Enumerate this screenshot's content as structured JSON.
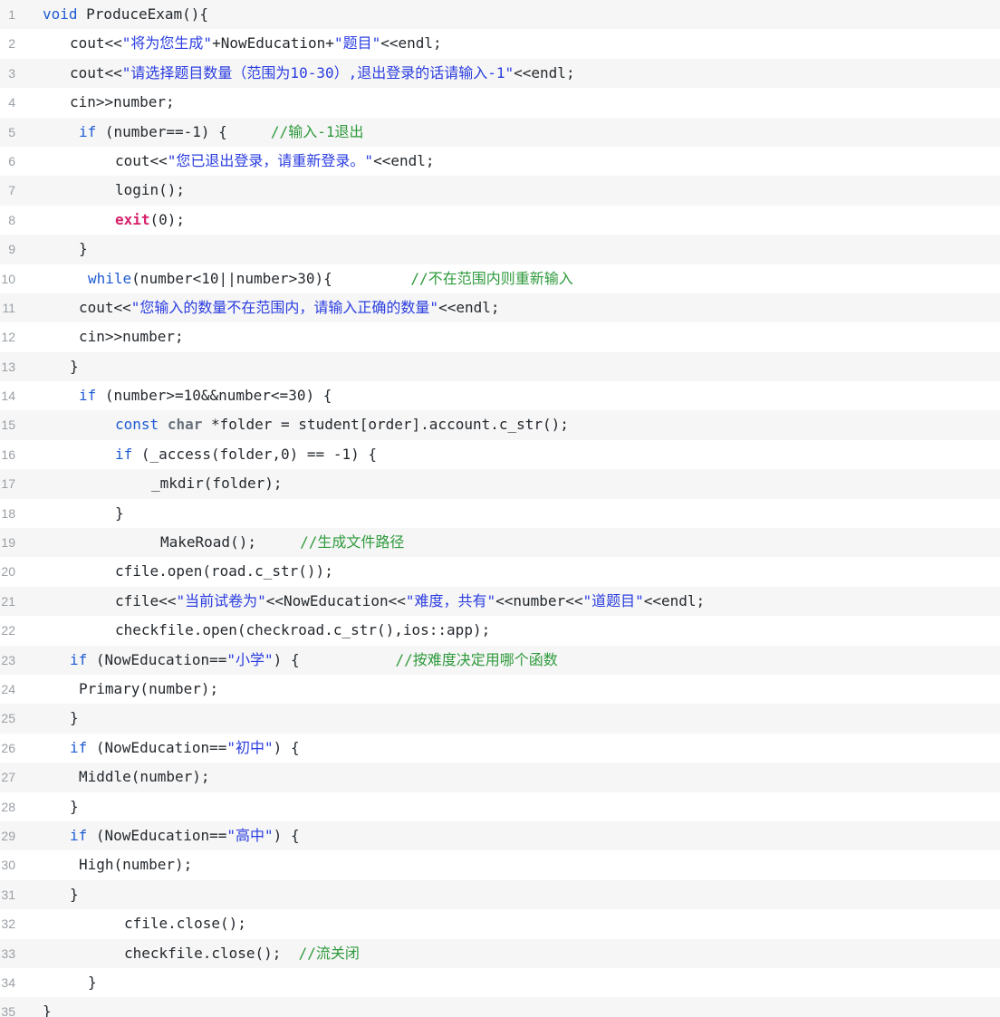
{
  "editor": {
    "lines": [
      {
        "num": "1",
        "indent": 0,
        "tokens": [
          {
            "t": "void",
            "c": "kw"
          },
          {
            "t": " ProduceExam(){",
            "c": ""
          }
        ]
      },
      {
        "num": "2",
        "indent": 3,
        "tokens": [
          {
            "t": "cout<<",
            "c": ""
          },
          {
            "t": "\"将为您生成\"",
            "c": "str"
          },
          {
            "t": "+NowEducation+",
            "c": ""
          },
          {
            "t": "\"题目\"",
            "c": "str"
          },
          {
            "t": "<<endl;",
            "c": ""
          }
        ]
      },
      {
        "num": "3",
        "indent": 3,
        "tokens": [
          {
            "t": "cout<<",
            "c": ""
          },
          {
            "t": "\"请选择题目数量（范围为10-30）,退出登录的话请输入-1\"",
            "c": "str"
          },
          {
            "t": "<<endl;",
            "c": ""
          }
        ]
      },
      {
        "num": "4",
        "indent": 3,
        "tokens": [
          {
            "t": "cin>>number;",
            "c": ""
          }
        ]
      },
      {
        "num": "5",
        "indent": 4,
        "tokens": [
          {
            "t": "if",
            "c": "kw"
          },
          {
            "t": " (number==-1) {     ",
            "c": ""
          },
          {
            "t": "//输入-1退出",
            "c": "cmt"
          }
        ]
      },
      {
        "num": "6",
        "indent": 8,
        "tokens": [
          {
            "t": "cout<<",
            "c": ""
          },
          {
            "t": "\"您已退出登录，请重新登录。\"",
            "c": "str"
          },
          {
            "t": "<<endl;",
            "c": ""
          }
        ]
      },
      {
        "num": "7",
        "indent": 8,
        "tokens": [
          {
            "t": "login();",
            "c": ""
          }
        ]
      },
      {
        "num": "8",
        "indent": 8,
        "tokens": [
          {
            "t": "exit",
            "c": "kw-exit"
          },
          {
            "t": "(0);",
            "c": ""
          }
        ]
      },
      {
        "num": "9",
        "indent": 4,
        "tokens": [
          {
            "t": "}",
            "c": ""
          }
        ]
      },
      {
        "num": "10",
        "indent": 5,
        "tokens": [
          {
            "t": "while",
            "c": "kw"
          },
          {
            "t": "(number<10||number>30){         ",
            "c": ""
          },
          {
            "t": "//不在范围内则重新输入",
            "c": "cmt"
          }
        ]
      },
      {
        "num": "11",
        "indent": 4,
        "tokens": [
          {
            "t": "cout<<",
            "c": ""
          },
          {
            "t": "\"您输入的数量不在范围内，请输入正确的数量\"",
            "c": "str"
          },
          {
            "t": "<<endl;",
            "c": ""
          }
        ]
      },
      {
        "num": "12",
        "indent": 4,
        "tokens": [
          {
            "t": "cin>>number;",
            "c": ""
          }
        ]
      },
      {
        "num": "13",
        "indent": 3,
        "tokens": [
          {
            "t": "}",
            "c": ""
          }
        ]
      },
      {
        "num": "14",
        "indent": 4,
        "tokens": [
          {
            "t": "if",
            "c": "kw"
          },
          {
            "t": " (number>=10&&number<=30) {",
            "c": ""
          }
        ]
      },
      {
        "num": "15",
        "indent": 8,
        "tokens": [
          {
            "t": "const",
            "c": "kw"
          },
          {
            "t": " ",
            "c": ""
          },
          {
            "t": "char",
            "c": "kw-type"
          },
          {
            "t": " *folder = student[order].account.c_str();",
            "c": ""
          }
        ]
      },
      {
        "num": "16",
        "indent": 8,
        "tokens": [
          {
            "t": "if",
            "c": "kw"
          },
          {
            "t": " (_access(folder,0) == -1) {",
            "c": ""
          }
        ]
      },
      {
        "num": "17",
        "indent": 12,
        "tokens": [
          {
            "t": "_mkdir(folder);",
            "c": ""
          }
        ]
      },
      {
        "num": "18",
        "indent": 8,
        "tokens": [
          {
            "t": "}",
            "c": ""
          }
        ]
      },
      {
        "num": "19",
        "indent": 13,
        "tokens": [
          {
            "t": "MakeRoad();     ",
            "c": ""
          },
          {
            "t": "//生成文件路径",
            "c": "cmt"
          }
        ]
      },
      {
        "num": "20",
        "indent": 8,
        "tokens": [
          {
            "t": "cfile.open(road.c_str());",
            "c": ""
          }
        ]
      },
      {
        "num": "21",
        "indent": 8,
        "tokens": [
          {
            "t": "cfile<<",
            "c": ""
          },
          {
            "t": "\"当前试卷为\"",
            "c": "str"
          },
          {
            "t": "<<NowEducation<<",
            "c": ""
          },
          {
            "t": "\"难度，共有\"",
            "c": "str"
          },
          {
            "t": "<<number<<",
            "c": ""
          },
          {
            "t": "\"道题目\"",
            "c": "str"
          },
          {
            "t": "<<endl;",
            "c": ""
          }
        ]
      },
      {
        "num": "22",
        "indent": 8,
        "tokens": [
          {
            "t": "checkfile.open(checkroad.c_str(),ios::app);",
            "c": ""
          }
        ]
      },
      {
        "num": "23",
        "indent": 3,
        "tokens": [
          {
            "t": "if",
            "c": "kw"
          },
          {
            "t": " (NowEducation==",
            "c": ""
          },
          {
            "t": "\"小学\"",
            "c": "str"
          },
          {
            "t": ") {           ",
            "c": ""
          },
          {
            "t": "//按难度决定用哪个函数",
            "c": "cmt"
          }
        ]
      },
      {
        "num": "24",
        "indent": 4,
        "tokens": [
          {
            "t": "Primary(number);",
            "c": ""
          }
        ]
      },
      {
        "num": "25",
        "indent": 3,
        "tokens": [
          {
            "t": "}",
            "c": ""
          }
        ]
      },
      {
        "num": "26",
        "indent": 3,
        "tokens": [
          {
            "t": "if",
            "c": "kw"
          },
          {
            "t": " (NowEducation==",
            "c": ""
          },
          {
            "t": "\"初中\"",
            "c": "str"
          },
          {
            "t": ") {",
            "c": ""
          }
        ]
      },
      {
        "num": "27",
        "indent": 4,
        "tokens": [
          {
            "t": "Middle(number);",
            "c": ""
          }
        ]
      },
      {
        "num": "28",
        "indent": 3,
        "tokens": [
          {
            "t": "}",
            "c": ""
          }
        ]
      },
      {
        "num": "29",
        "indent": 3,
        "tokens": [
          {
            "t": "if",
            "c": "kw"
          },
          {
            "t": " (NowEducation==",
            "c": ""
          },
          {
            "t": "\"高中\"",
            "c": "str"
          },
          {
            "t": ") {",
            "c": ""
          }
        ]
      },
      {
        "num": "30",
        "indent": 4,
        "tokens": [
          {
            "t": "High(number);",
            "c": ""
          }
        ]
      },
      {
        "num": "31",
        "indent": 3,
        "tokens": [
          {
            "t": "}",
            "c": ""
          }
        ]
      },
      {
        "num": "32",
        "indent": 9,
        "tokens": [
          {
            "t": "cfile.close();",
            "c": ""
          }
        ]
      },
      {
        "num": "33",
        "indent": 9,
        "tokens": [
          {
            "t": "checkfile.close();  ",
            "c": ""
          },
          {
            "t": "//流关闭",
            "c": "cmt"
          }
        ]
      },
      {
        "num": "34",
        "indent": 5,
        "tokens": [
          {
            "t": "}",
            "c": ""
          }
        ]
      },
      {
        "num": "35",
        "indent": 0,
        "tokens": [
          {
            "t": "}",
            "c": ""
          }
        ]
      }
    ]
  },
  "colors": {
    "gutter_rule": "#7ccf6d",
    "keyword": "#1e5bd3",
    "exit_keyword": "#d6236b",
    "string": "#2b3de0",
    "comment": "#2e9a3c"
  }
}
